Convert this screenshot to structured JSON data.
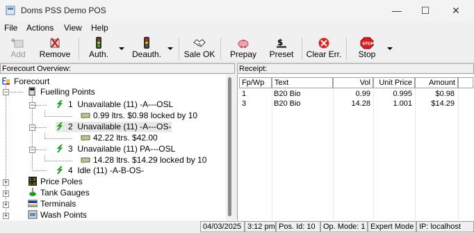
{
  "window": {
    "title": "Doms PSS Demo POS"
  },
  "menu": [
    "File",
    "Actions",
    "View",
    "Help"
  ],
  "toolbar": {
    "add": "Add",
    "remove": "Remove",
    "auth": "Auth.",
    "deauth": "Deauth.",
    "sale_ok": "Sale OK",
    "prepay": "Prepay",
    "preset": "Preset",
    "clear_err": "Clear Err.",
    "stop": "Stop"
  },
  "forecourt_panel": {
    "header": "Forecourt Overview:",
    "root": "Forecourt",
    "fuelling_points": "Fuelling Points",
    "fps": [
      {
        "num": "1",
        "status": "Unavailable (11) -A---OSL",
        "sale": "0.99 ltrs.  $0.98   locked by 10"
      },
      {
        "num": "2",
        "status": "Unavailable (11) -A---OS-",
        "sale": "42.22 ltrs.  $42.00"
      },
      {
        "num": "3",
        "status": "Unavailable (11) PA---OSL",
        "sale": "14.28 ltrs.  $14.29   locked by 10"
      },
      {
        "num": "4",
        "status": "Idle (11) -A-B-OS-"
      }
    ],
    "price_poles": "Price Poles",
    "tank_gauges": "Tank Gauges",
    "terminals": "Terminals",
    "wash_points": "Wash Points"
  },
  "receipt_panel": {
    "header": "Receipt:",
    "columns": [
      "Fp/Wp",
      "Text",
      "Vol",
      "Unit Price",
      "Amount"
    ],
    "rows": [
      [
        "1",
        "B20 Bio",
        "0.99",
        "0.995",
        "$0.98"
      ],
      [
        "3",
        "B20 Bio",
        "14.28",
        "1.001",
        "$14.29"
      ]
    ]
  },
  "status": {
    "date": "04/03/2025",
    "time": "3:12 pm",
    "pos_id": "Pos. Id:  10",
    "op_mode": "Op. Mode:  1",
    "mode": "Expert Mode",
    "ip": "IP: localhost"
  }
}
